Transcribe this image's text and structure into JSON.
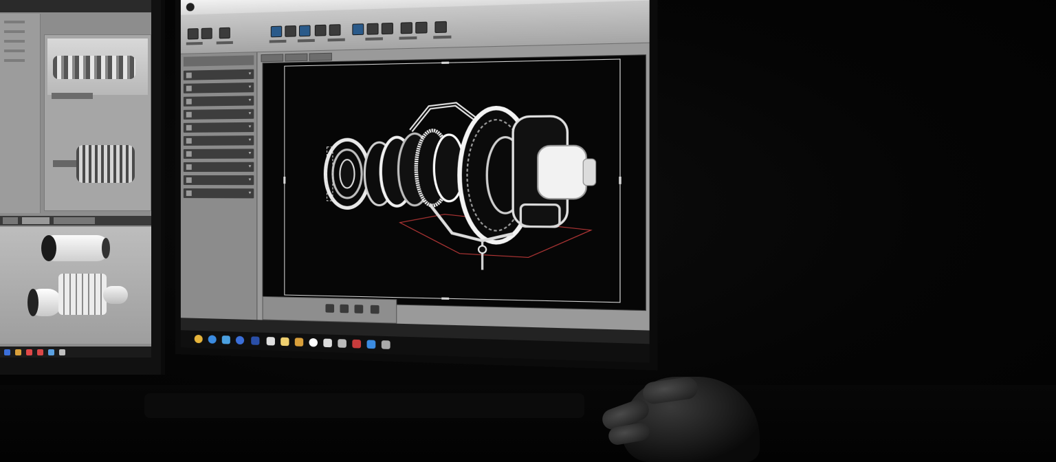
{
  "left_app": {
    "title": "",
    "taskbar_icon_colors": [
      "#3b6fd9",
      "#d9a03b",
      "#e04848",
      "#d94848",
      "#5aa0e0",
      "#c0c0c0"
    ]
  },
  "main_app": {
    "title": "",
    "window_controls": "– ☐ ✕",
    "ribbon_tabs": [
      "",
      "",
      "",
      "",
      "",
      "",
      "",
      ""
    ],
    "tree_items": [
      "",
      "",
      "",
      "",
      "",
      "",
      "",
      "",
      "",
      ""
    ],
    "view_cube_label": "",
    "status_coords": "",
    "taskbar_icon_colors": [
      "#e6b43b",
      "#3b8be0",
      "#4ba0e0",
      "#3b6fd9",
      "#2a4fa8",
      "#e0e0e0",
      "#f0d070",
      "#d9a03b",
      "#ffffff",
      "#dddddd",
      "#bbbbbb",
      "#f0f0f0",
      "#c83c3c",
      "#3b8be0",
      "#aaaaaa",
      "#888888"
    ],
    "viewport_accent": "#c23a3a"
  }
}
